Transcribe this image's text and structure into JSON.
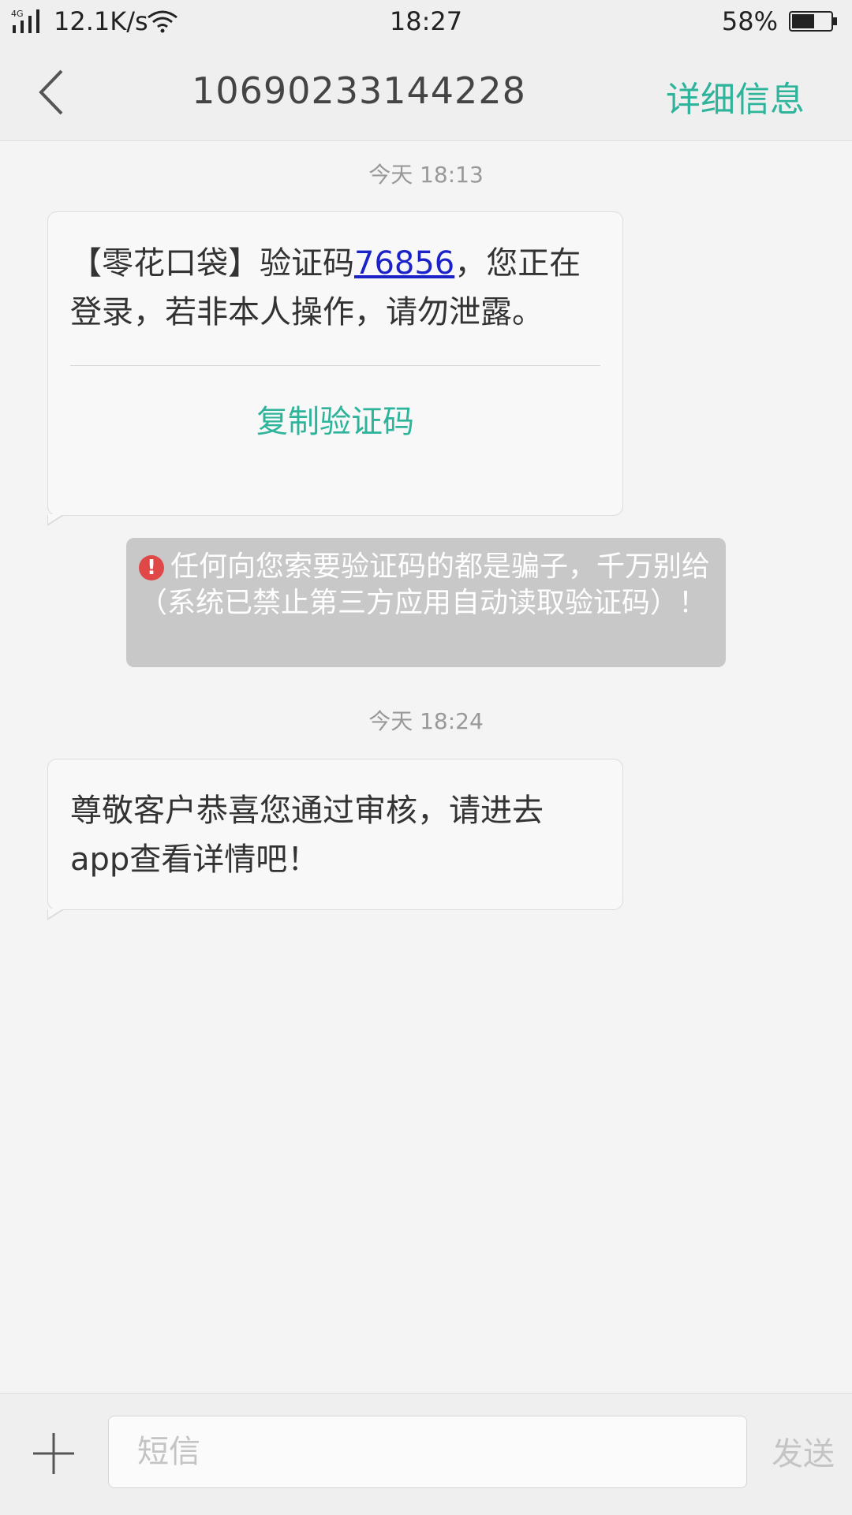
{
  "status_bar": {
    "network": "4G",
    "speed": "12.1K/s",
    "time": "18:27",
    "battery": "58%"
  },
  "header": {
    "title": "10690233144228",
    "detail_label": "详细信息"
  },
  "messages": [
    {
      "timestamp": "今天 18:13",
      "text_before": "【零花口袋】验证码",
      "code": "76856",
      "text_after": "，您正在登录，若非本人操作，请勿泄露。",
      "copy_label": "复制验证码"
    },
    {
      "timestamp": "今天 18:24",
      "text": "尊敬客户恭喜您通过审核，请进去app查看详情吧！"
    }
  ],
  "warning": {
    "icon": "exclamation-icon",
    "text": "任何向您索要验证码的都是骗子，千万别给（系统已禁止第三方应用自动读取验证码）！"
  },
  "composer": {
    "placeholder": "短信",
    "value": "",
    "send_label": "发送"
  },
  "colors": {
    "accent": "#2db49b",
    "link": "#1a22c8",
    "warning_bg": "#c8c8c8",
    "warning_icon": "#e04848"
  }
}
